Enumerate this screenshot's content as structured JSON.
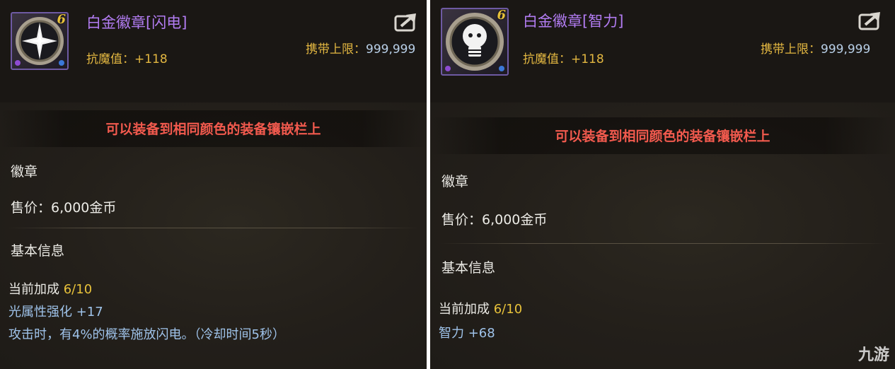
{
  "left": {
    "title": "白金徽章[闪电]",
    "level": "6",
    "stat": "抗魔值：+118",
    "carry_label": "携带上限：",
    "carry_value": "999,999",
    "banner": "可以装备到相同颜色的装备镶嵌栏上",
    "category": "徽章",
    "price": "售价：6,000金币",
    "section": "基本信息",
    "bonus_label": "当前加成 ",
    "bonus_value": "6/10",
    "attr": "光属性强化 +17",
    "effect": "攻击时，有4%的概率施放闪电。（冷却时间5秒）"
  },
  "right": {
    "title": "白金徽章[智力]",
    "level": "6",
    "stat": "抗魔值：+118",
    "carry_label": "携带上限：",
    "carry_value": "999,999",
    "banner": "可以装备到相同颜色的装备镶嵌栏上",
    "category": "徽章",
    "price": "售价：6,000金币",
    "section": "基本信息",
    "bonus_label": "当前加成 ",
    "bonus_value": "6/10",
    "attr": "智力 +68"
  },
  "watermark": "九游",
  "icons": {
    "left_item": "lightning-star-emblem-icon",
    "right_item": "intelligence-bulb-emblem-icon",
    "share": "share-arrow-icon"
  },
  "colors": {
    "title": "#b27cf2",
    "stat": "#e3b741",
    "banner": "#f25a4e",
    "gold": "#e8c23a"
  }
}
